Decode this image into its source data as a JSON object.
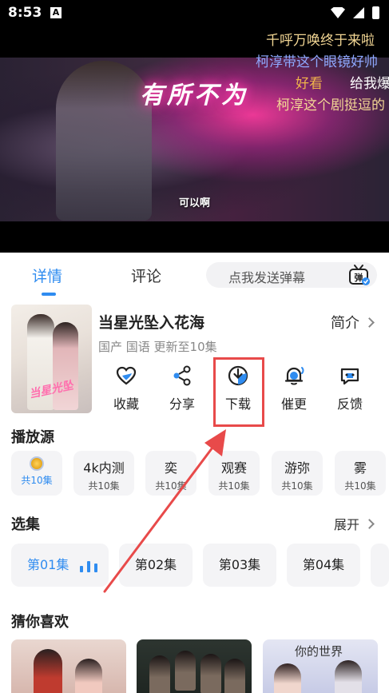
{
  "status_bar": {
    "time": "8:53",
    "notification_letter": "A"
  },
  "video": {
    "subtitle": "可以啊",
    "neon_sign": "有所不为",
    "danmaku": [
      {
        "text": "千呼万唤终于来啦",
        "color": "#f2d694"
      },
      {
        "text": "柯淳带这个眼镜好帅",
        "color": "#8fa8ff"
      },
      {
        "text": "好看",
        "color": "#f0b44a"
      },
      {
        "text": "给我爆",
        "color": "#ffffff"
      },
      {
        "text": "柯淳这个剧挺逗的",
        "color": "#f2d694"
      }
    ]
  },
  "tabs": {
    "detail": "详情",
    "comment": "评论"
  },
  "danmu_input": {
    "placeholder": "点我发送弹幕",
    "send_icon_label": "弹"
  },
  "show": {
    "title": "当星光坠入花海",
    "meta": "国产 国语 更新至10集",
    "intro_label": "简介",
    "poster_logo": "当星光坠入花海"
  },
  "actions": [
    {
      "label": "收藏",
      "icon": "heart-icon"
    },
    {
      "label": "分享",
      "icon": "share-icon"
    },
    {
      "label": "下载",
      "icon": "download-icon"
    },
    {
      "label": "催更",
      "icon": "bell-icon"
    },
    {
      "label": "反馈",
      "icon": "feedback-icon"
    }
  ],
  "sources_section": {
    "title": "播放源",
    "items": [
      {
        "name": "",
        "count": "共10集",
        "icon": "medal-icon",
        "active": true
      },
      {
        "name": "4k内测",
        "count": "共10集"
      },
      {
        "name": "奕",
        "count": "共10集"
      },
      {
        "name": "观赛",
        "count": "共10集"
      },
      {
        "name": "游弥",
        "count": "共10集"
      },
      {
        "name": "雾",
        "count": "共10集"
      }
    ]
  },
  "episodes_section": {
    "title": "选集",
    "expand_label": "展开",
    "items": [
      "第01集",
      "第02集",
      "第03集",
      "第04集"
    ]
  },
  "recommend_section": {
    "title": "猜你喜欢",
    "card3_title": "你的世界"
  },
  "colors": {
    "accent": "#2f8cf0",
    "annotation": "#e84a4a"
  }
}
